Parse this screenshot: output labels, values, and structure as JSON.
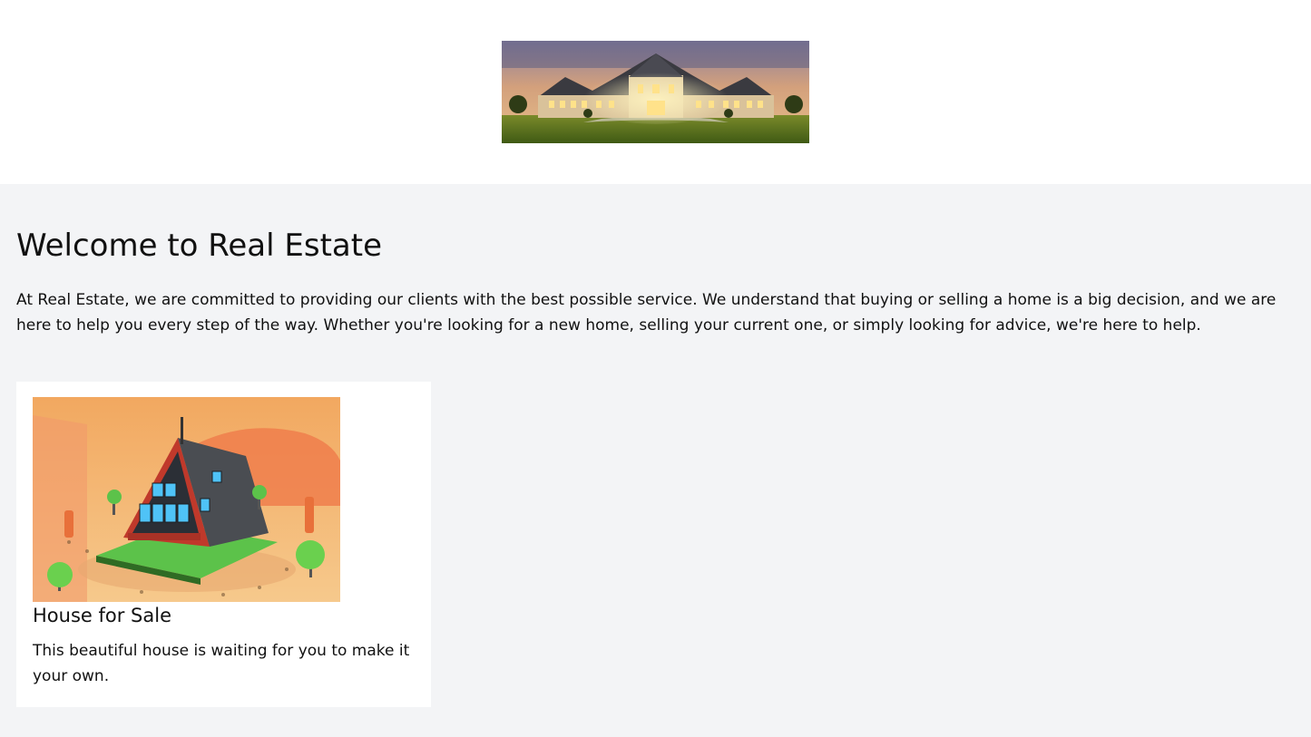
{
  "header": {
    "hero_image": "luxury-mansion-dusk-image"
  },
  "main": {
    "title": "Welcome to Real Estate",
    "intro": "At Real Estate, we are committed to providing our clients with the best possible service. We understand that buying or selling a home is a big decision, and we are here to help you every step of the way. Whether you're looking for a new home, selling your current one, or simply looking for advice, we're here to help."
  },
  "listings": [
    {
      "image": "a-frame-house-illustration",
      "title": "House for Sale",
      "description": "This beautiful house is waiting for you to make it your own."
    }
  ],
  "colors": {
    "page_bg": "#f3f4f6",
    "header_bg": "#ffffff",
    "card_bg": "#ffffff",
    "text": "#111111"
  }
}
